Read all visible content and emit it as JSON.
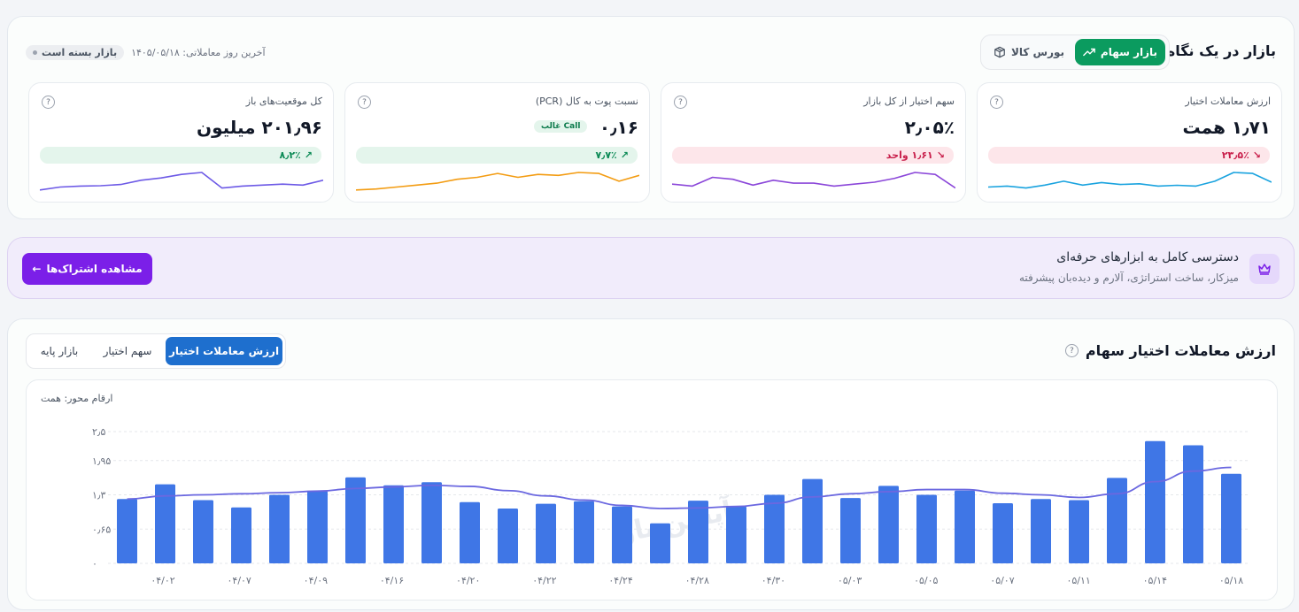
{
  "overview": {
    "title": "بازار در یک نگاه",
    "market_tabs": [
      {
        "label": "بازار سهام",
        "active": true
      },
      {
        "label": "بورس کالا",
        "active": false
      }
    ],
    "status_badge": "بازار بسته است",
    "last_trading_day": "آخرین روز معاملاتی: ۱۴۰۵/۰۵/۱۸",
    "cards": [
      {
        "label": "ارزش معاملات اختیار",
        "value": "۱٫۷۱ همت",
        "change": "۲۳٫۵٪",
        "direction": "down",
        "color": "#1aa3df",
        "spark": [
          0.25,
          0.3,
          0.2,
          0.35,
          0.55,
          0.35,
          0.48,
          0.38,
          0.42,
          0.3,
          0.34,
          0.3,
          0.55,
          1.0,
          0.95,
          0.5
        ]
      },
      {
        "label": "سهم اختیار از کل بازار",
        "value": "۲٫۰۵٪",
        "change": "۱٫۶۱ واحد",
        "direction": "down",
        "color": "#8b47d9",
        "spark": [
          0.4,
          0.3,
          0.75,
          0.65,
          0.35,
          0.6,
          0.45,
          0.45,
          0.3,
          0.4,
          0.5,
          0.7,
          1.0,
          0.9,
          0.2
        ]
      },
      {
        "label": "نسبت پوت به کال (PCR)",
        "value": "۰٫۱۶",
        "extra": "Call غالب",
        "change": "۷٫۷٪",
        "direction": "up",
        "color": "#f39c12",
        "spark": [
          0.1,
          0.15,
          0.25,
          0.35,
          0.45,
          0.65,
          0.75,
          0.95,
          0.75,
          0.9,
          0.85,
          1.0,
          0.95,
          0.55,
          0.85
        ]
      },
      {
        "label": "کل موقعیت‌های باز",
        "value": "۲۰۱٫۹۶ میلیون",
        "change": "۸٫۲٪",
        "direction": "up",
        "color": "#6d5ae6",
        "spark": [
          0.1,
          0.25,
          0.3,
          0.32,
          0.38,
          0.6,
          0.72,
          0.9,
          1.0,
          0.2,
          0.3,
          0.35,
          0.4,
          0.35,
          0.6
        ]
      }
    ]
  },
  "promo": {
    "title": "دسترسی کامل به ابزارهای حرفه‌ای",
    "subtitle": "میزکار، ساخت استراتژی، آلارم و دیده‌بان پیشرفته",
    "button_label": "مشاهده اشتراک‌ها"
  },
  "chart_section": {
    "title": "ارزش معاملات اختیار سهام",
    "tabs": [
      {
        "label": "ارزش معاملات اختیار",
        "active": true
      },
      {
        "label": "سهم اختیار",
        "active": false
      },
      {
        "label": "بازار پایه",
        "active": false
      }
    ],
    "axis_unit": "ارقام محور: همت",
    "watermark": "آپشن باز"
  },
  "chart_data": {
    "type": "bar",
    "ylim": [
      0,
      2.6
    ],
    "y_ticks": [
      0,
      0.65,
      1.3,
      1.95,
      2.5
    ],
    "y_tick_labels": [
      "۰",
      "۰٫۶۵",
      "۱٫۳",
      "۱٫۹۵",
      "۲٫۵"
    ],
    "x_tick_labels": [
      "۰۴/۰۲",
      "۰۴/۰۷",
      "۰۴/۰۹",
      "۰۴/۱۶",
      "۰۴/۲۰",
      "۰۴/۲۲",
      "۰۴/۲۴",
      "۰۴/۲۸",
      "۰۴/۳۰",
      "۰۵/۰۳",
      "۰۵/۰۵",
      "۰۵/۰۷",
      "۰۵/۱۱",
      "۰۵/۱۴",
      "۰۵/۱۸"
    ],
    "bar_color": "#3f76e6",
    "line_color": "#6b68e0",
    "values": [
      1.22,
      1.5,
      1.2,
      1.06,
      1.3,
      1.37,
      1.63,
      1.48,
      1.54,
      1.16,
      1.04,
      1.13,
      1.18,
      1.08,
      0.76,
      1.19,
      1.08,
      1.3,
      1.6,
      1.24,
      1.47,
      1.3,
      1.38,
      1.14,
      1.22,
      1.2,
      1.62,
      2.32,
      2.24,
      1.7
    ],
    "trend": [
      1.22,
      1.28,
      1.3,
      1.32,
      1.34,
      1.37,
      1.42,
      1.45,
      1.48,
      1.46,
      1.38,
      1.28,
      1.2,
      1.1,
      1.04,
      1.05,
      1.08,
      1.14,
      1.26,
      1.32,
      1.36,
      1.4,
      1.4,
      1.33,
      1.3,
      1.25,
      1.32,
      1.55,
      1.75,
      1.82
    ]
  }
}
